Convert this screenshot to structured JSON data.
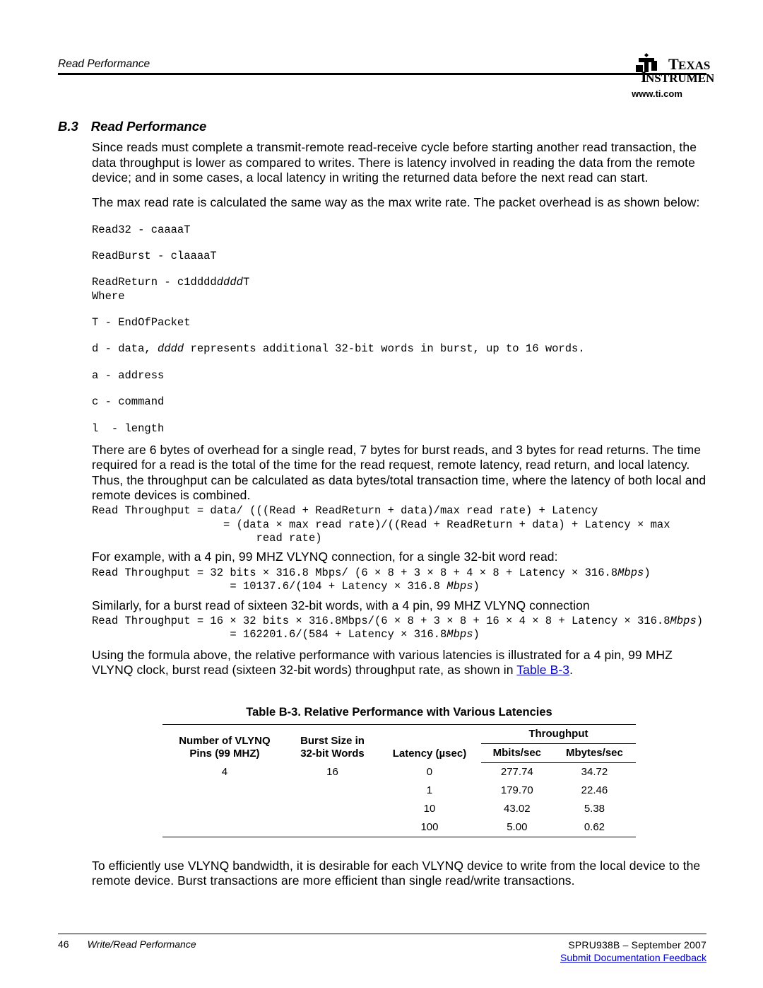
{
  "header": {
    "logo_url": "www.ti.com",
    "topic_label": "Read Performance"
  },
  "section": {
    "number": "B.3",
    "title": "Read Performance",
    "para1": "Since reads must complete a transmit-remote read-receive cycle before starting another read transaction, the data throughput is lower as compared to writes. There is latency involved in reading the data from the remote device; and in some cases, a local latency in writing the returned data before the next read can start.",
    "para2": "The max read rate is calculated the same way as the max write rate. The packet overhead is as shown below:",
    "code1_l1": "Read32 - caaaaT",
    "code1_l2": "ReadBurst - claaaaT",
    "code1_l3a": "ReadReturn - c1dddd",
    "code1_l3b": "dddd",
    "code1_l3c": "T",
    "code1_l4": "Where",
    "code1_l5": "T - EndOfPacket",
    "code1_l6a": "d - data, ",
    "code1_l6b": "dddd",
    "code1_l6c": " represents additional 32-bit words in burst, up to 16 words.",
    "code1_l7": "a - address",
    "code1_l8": "c - command",
    "code1_l9": "l  - length",
    "para3": "There are 6 bytes of overhead for a single read, 7 bytes for burst reads, and 3 bytes for read returns. The time required for a read is the total of the time for the read request, remote latency, read return, and local latency. Thus, the throughput can be calculated as data bytes/total transaction time, where the latency of both local and remote devices is combined.",
    "code2_l1": "Read Throughput = data/ (((Read + ReadReturn + data)/max read rate) + Latency",
    "code2_l2": "                    = (data × max read rate)/((Read + ReadReturn + data) + Latency × max",
    "code2_l3": "                         read rate)",
    "para4": "For example, with a 4 pin, 99 MHZ VLYNQ connection, for a single 32-bit word read:",
    "code3_l1a": "Read Throughput = 32 bits × 316.8 Mbps/ (6 × 8 + 3 × 8 + 4 × 8 + Latency × 316.8",
    "code3_l1b": "Mbps",
    "code3_l1c": ")",
    "code3_l2a": "                     = 10137.6/(104 + Latency × 316.8 ",
    "code3_l2b": "Mbps",
    "code3_l2c": ")",
    "para5": "Similarly, for a burst read of sixteen 32-bit words, with a 4 pin, 99 MHZ VLYNQ connection",
    "code4_l1a": "Read Throughput = 16 × 32 bits × 316.8Mbps/(6 × 8 + 3 × 8 + 16 × 4 × 8 + Latency × 316.8",
    "code4_l1b": "Mbps",
    "code4_l1c": ")",
    "code4_l2a": "                     = 162201.6/(584 + Latency × 316.8",
    "code4_l2b": "Mbps",
    "code4_l2c": ")",
    "para6a": "Using the formula above, the relative performance with various latencies is illustrated for a 4 pin, 99 MHZ VLYNQ clock, burst read (sixteen 32-bit words) throughput rate, as shown in ",
    "table_ref": "Table B-3",
    "para6b": ".",
    "table_title": "Table B-3. Relative Performance with Various Latencies",
    "th_pins_1": "Number of VLYNQ",
    "th_pins_2": "Pins (99 MHZ)",
    "th_burst_1": "Burst Size in",
    "th_burst_2": "32-bit Words",
    "th_latency": "Latency (µsec)",
    "th_throughput": "Throughput",
    "th_mbits": "Mbits/sec",
    "th_mbytes": "Mbytes/sec",
    "rows": [
      {
        "pins": "4",
        "burst": "16",
        "lat": "0",
        "mbits": "277.74",
        "mbytes": "34.72"
      },
      {
        "pins": "",
        "burst": "",
        "lat": "1",
        "mbits": "179.70",
        "mbytes": "22.46"
      },
      {
        "pins": "",
        "burst": "",
        "lat": "10",
        "mbits": "43.02",
        "mbytes": "5.38"
      },
      {
        "pins": "",
        "burst": "",
        "lat": "100",
        "mbits": "5.00",
        "mbytes": "0.62"
      }
    ],
    "para7": "To efficiently use VLYNQ bandwidth, it is desirable for each VLYNQ device to write from the local device to the remote device. Burst transactions are more efficient than single read/write transactions."
  },
  "footer": {
    "page": "46",
    "section": "Write/Read Performance",
    "docid": "SPRU938B – September 2007",
    "feedback": "Submit Documentation Feedback"
  },
  "chart_data": {
    "type": "table",
    "title": "Table B-3. Relative Performance with Various Latencies",
    "columns": [
      "Number of VLYNQ Pins (99 MHZ)",
      "Burst Size in 32-bit Words",
      "Latency (µsec)",
      "Mbits/sec",
      "Mbytes/sec"
    ],
    "rows": [
      [
        4,
        16,
        0,
        277.74,
        34.72
      ],
      [
        4,
        16,
        1,
        179.7,
        22.46
      ],
      [
        4,
        16,
        10,
        43.02,
        5.38
      ],
      [
        4,
        16,
        100,
        5.0,
        0.62
      ]
    ]
  }
}
